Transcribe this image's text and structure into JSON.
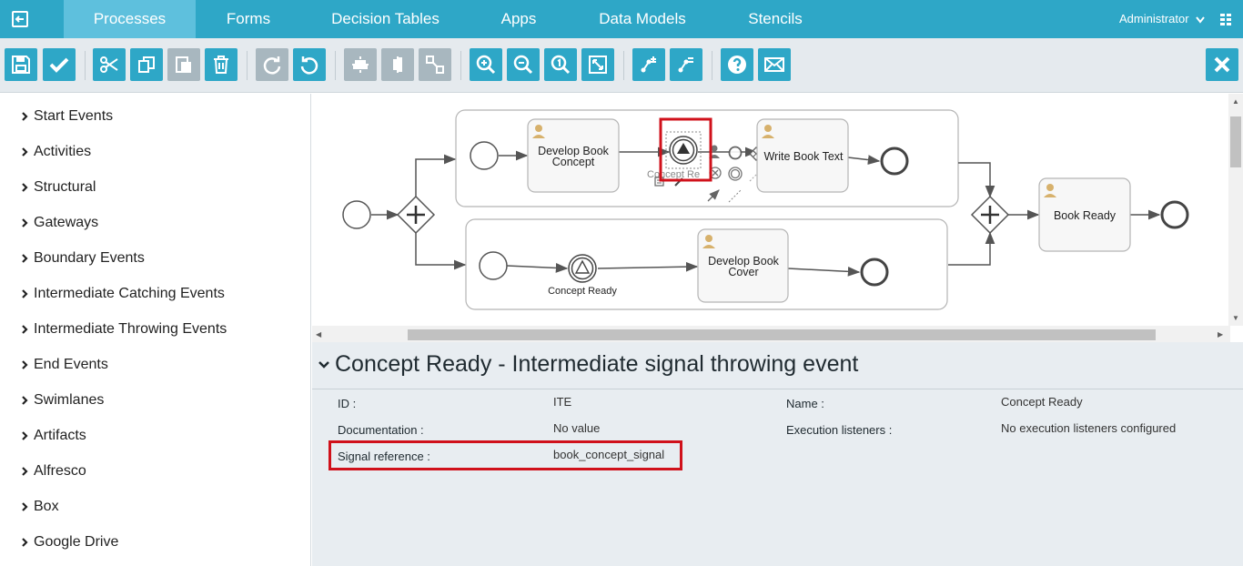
{
  "nav": {
    "tabs": [
      "Processes",
      "Forms",
      "Decision Tables",
      "Apps",
      "Data Models",
      "Stencils"
    ],
    "active_tab": "Processes",
    "user": "Administrator"
  },
  "toolbar": {
    "buttons": [
      "save-icon",
      "validate-icon",
      "cut-icon",
      "copy-icon",
      "paste-icon",
      "delete-icon",
      "redo-icon",
      "undo-icon",
      "align-horizontal-icon",
      "align-vertical-icon",
      "same-size-icon",
      "zoom-in-icon",
      "zoom-out-icon",
      "zoom-actual-icon",
      "zoom-fit-icon",
      "bendpoint-add-icon",
      "bendpoint-remove-icon",
      "help-icon",
      "feedback-icon",
      "close-icon"
    ]
  },
  "palette": {
    "groups": [
      "Start Events",
      "Activities",
      "Structural",
      "Gateways",
      "Boundary Events",
      "Intermediate Catching Events",
      "Intermediate Throwing Events",
      "End Events",
      "Swimlanes",
      "Artifacts",
      "Alfresco",
      "Box",
      "Google Drive"
    ]
  },
  "diagram": {
    "task_develop_concept": [
      "Develop Book",
      "Concept"
    ],
    "task_write_text": "Write Book Text",
    "task_develop_cover": [
      "Develop Book",
      "Cover"
    ],
    "task_book_ready": "Book Ready",
    "event_concept_ready": "Concept Ready",
    "selected_event_label": "Concept Re"
  },
  "properties": {
    "title": "Concept Ready - Intermediate signal throwing event",
    "id_label": "ID :",
    "id_value": "ITE",
    "name_label": "Name :",
    "name_value": "Concept Ready",
    "documentation_label": "Documentation :",
    "documentation_value": "No value",
    "listeners_label": "Execution listeners :",
    "listeners_value": "No execution listeners configured",
    "signal_label": "Signal reference :",
    "signal_value": "book_concept_signal"
  },
  "colors": {
    "primary": "#2ea7c7",
    "active_tab": "#5ec0dd",
    "toolbar_bg": "#e5eaee",
    "disabled_button": "#a8b7bf",
    "highlight": "#d0111b",
    "task_fill": "#f7f7f7"
  }
}
